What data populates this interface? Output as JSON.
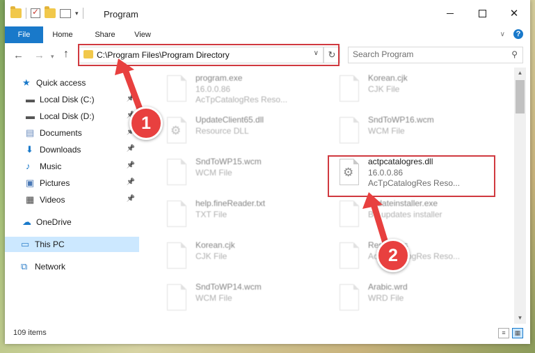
{
  "window": {
    "title": "Program",
    "close_glyph": "✕"
  },
  "ribbon": {
    "tabs": [
      "File",
      "Home",
      "Share",
      "View"
    ]
  },
  "address": {
    "path": "C:\\Program Files\\Program Directory"
  },
  "search": {
    "placeholder": "Search Program"
  },
  "sidebar": {
    "items": [
      {
        "label": "Quick access",
        "icon": "star-icon",
        "color": "#1979ca"
      },
      {
        "label": "Local Disk (C:)",
        "icon": "drive-icon",
        "color": "#555555",
        "pinned": true
      },
      {
        "label": "Local Disk (D:)",
        "icon": "drive-icon",
        "color": "#555555",
        "pinned": true
      },
      {
        "label": "Documents",
        "icon": "documents-icon",
        "color": "#6c8ebf",
        "pinned": true
      },
      {
        "label": "Downloads",
        "icon": "downloads-icon",
        "color": "#1979ca",
        "pinned": true
      },
      {
        "label": "Music",
        "icon": "music-icon",
        "color": "#1979ca",
        "pinned": true
      },
      {
        "label": "Pictures",
        "icon": "pictures-icon",
        "color": "#4a78b5",
        "pinned": true
      },
      {
        "label": "Videos",
        "icon": "videos-icon",
        "color": "#444444",
        "pinned": true
      },
      {
        "label": "OneDrive",
        "icon": "onedrive-icon",
        "color": "#1979ca"
      },
      {
        "label": "This PC",
        "icon": "computer-icon",
        "color": "#2f7fc9",
        "selected": true
      },
      {
        "label": "Network",
        "icon": "network-icon",
        "color": "#2f7fc9"
      }
    ]
  },
  "files": [
    {
      "name": "program.exe",
      "sub1": "16.0.0.86",
      "sub2": "AcTpCatalogRes Reso...",
      "blur": true
    },
    {
      "name": "Korean.cjk",
      "sub1": "CJK File",
      "sub2": "",
      "blur": true
    },
    {
      "name": "UpdateClient65.dll",
      "sub1": "Resource DLL",
      "sub2": "",
      "blur": true
    },
    {
      "name": "SndToWP16.wcm",
      "sub1": "WCM File",
      "sub2": "",
      "blur": true
    },
    {
      "name": "SndToWP15.wcm",
      "sub1": "WCM File",
      "sub2": "",
      "blur": true
    },
    {
      "name": "actpcatalogres.dll",
      "sub1": "16.0.0.86",
      "sub2": "AcTpCatalogRes Reso...",
      "blur": false
    },
    {
      "name": "help.fineReader.txt",
      "sub1": "TXT File",
      "sub2": "",
      "blur": true
    },
    {
      "name": "updateinstaller.exe",
      "sub1": "BY updates installer",
      "sub2": "",
      "blur": true
    },
    {
      "name": "Korean.cjk",
      "sub1": "CJK File",
      "sub2": "",
      "blur": true
    },
    {
      "name": "Resources",
      "sub1": "AcTpCatalogRes Reso...",
      "sub2": "",
      "blur": true
    },
    {
      "name": "SndToWP14.wcm",
      "sub1": "WCM File",
      "sub2": "",
      "blur": true
    },
    {
      "name": "Arabic.wrd",
      "sub1": "WRD File",
      "sub2": "",
      "blur": true
    }
  ],
  "status": {
    "count": "109 items"
  },
  "annotations": {
    "step1": "1",
    "step2": "2",
    "highlight_color": "#d0393f"
  }
}
